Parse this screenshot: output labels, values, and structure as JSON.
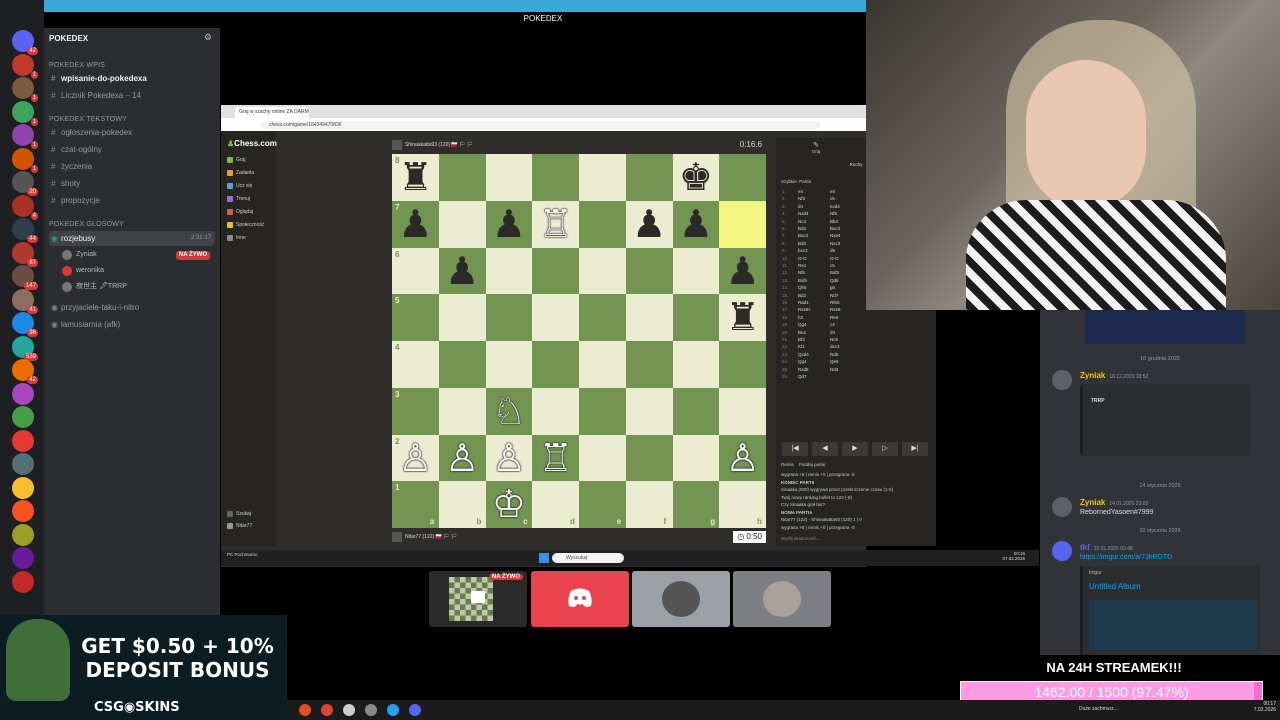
{
  "stream_title": "POKEDEX",
  "discord": {
    "server_name": "POKEDEX",
    "rail_badges": [
      "42",
      "1",
      "1",
      "1",
      "1",
      "1",
      "20",
      "4",
      "44",
      "87",
      "147",
      "41",
      "96",
      "539",
      "42"
    ],
    "categories": [
      {
        "label": "POKEDEX Wpis"
      },
      {
        "label": "POKEDEX Tekstowy"
      },
      {
        "label": "POKEDEX GŁOSOWY"
      }
    ],
    "channels_wpis": [
      "wpisanie-do-pokedexa",
      "Licznik Pokedexa – 14"
    ],
    "channels_text": [
      "ogłoszenia-pokedex",
      "czat-ogólny",
      "życzenia",
      "shoty",
      "propozycje"
    ],
    "voice_channel": {
      "name": "rozjebusy",
      "time": "2:31:17"
    },
    "voice_users": [
      {
        "name": "Zyniak",
        "live": "NA ŻYWO"
      },
      {
        "name": "weronika",
        "live": ""
      },
      {
        "name": "寂世主 🖋TRRP",
        "live": ""
      }
    ],
    "other_voice": [
      "przyjaciele-taku-i-nitro",
      "lamusiarnia (afk)"
    ]
  },
  "browser": {
    "tab_title": "Graj w szachy online ZA DARM",
    "url": "chess.com/game/164349470836"
  },
  "chess": {
    "logo": "Chess.com",
    "menu": [
      "Graj",
      "Zadania",
      "Ucz się",
      "Trenuj",
      "Oglądaj",
      "Społeczność",
      "Inne"
    ],
    "bottom_menu": [
      "Szukaj",
      "Nitar77"
    ],
    "top_player": "Shinaakatta93 (120) 🇵🇱 🏳 🏳",
    "top_clock": "0:16.6",
    "bottom_player": "Nitar77 (122) 🇵🇱 🏳 🏳",
    "bottom_clock": "0:50",
    "ranks": [
      "8",
      "7",
      "6",
      "5",
      "4",
      "3",
      "2",
      "1"
    ],
    "files": [
      "a",
      "b",
      "c",
      "d",
      "e",
      "f",
      "g",
      "h"
    ],
    "pieces": [
      {
        "sq": "a8",
        "p": "♜",
        "c": "b"
      },
      {
        "sq": "g8",
        "p": "♚",
        "c": "b"
      },
      {
        "sq": "a7",
        "p": "♟",
        "c": "b"
      },
      {
        "sq": "c7",
        "p": "♟",
        "c": "b"
      },
      {
        "sq": "d7",
        "p": "♖",
        "c": "w"
      },
      {
        "sq": "f7",
        "p": "♟",
        "c": "b"
      },
      {
        "sq": "g7",
        "p": "♟",
        "c": "b"
      },
      {
        "sq": "b6",
        "p": "♟",
        "c": "b"
      },
      {
        "sq": "h6",
        "p": "♟",
        "c": "b"
      },
      {
        "sq": "h5",
        "p": "♜",
        "c": "b"
      },
      {
        "sq": "c3",
        "p": "♘",
        "c": "w"
      },
      {
        "sq": "a2",
        "p": "♙",
        "c": "w"
      },
      {
        "sq": "b2",
        "p": "♙",
        "c": "w"
      },
      {
        "sq": "c2",
        "p": "♙",
        "c": "w"
      },
      {
        "sq": "d2",
        "p": "♖",
        "c": "w"
      },
      {
        "sq": "h2",
        "p": "♙",
        "c": "w"
      },
      {
        "sq": "c1",
        "p": "♔",
        "c": "w"
      }
    ],
    "highlight": [
      "h7"
    ],
    "panel_tabs": [
      "Graj",
      "Nowa partia"
    ],
    "panel_sub": "Ruchy",
    "panel_head": "Szybkie: Partia",
    "moves": [
      [
        "1.",
        "e4",
        "e5"
      ],
      [
        "2.",
        "Nf3",
        "c6"
      ],
      [
        "3.",
        "d4",
        "exd4"
      ],
      [
        "4.",
        "Nxd4",
        "Nf6"
      ],
      [
        "5.",
        "Nc3",
        "Bb4"
      ],
      [
        "6.",
        "Bd2",
        "Bxc3"
      ],
      [
        "7.",
        "Bxc3",
        "Nxe4"
      ],
      [
        "8.",
        "Bd3",
        "Nxc3"
      ],
      [
        "9.",
        "bxc3",
        "d5"
      ],
      [
        "10.",
        "O-O",
        "O-O"
      ],
      [
        "11.",
        "Re1",
        "c5"
      ],
      [
        "12.",
        "Nf5",
        "Bxf5"
      ],
      [
        "13.",
        "Bxf5",
        "Qd6"
      ],
      [
        "14.",
        "Qh5",
        "g6"
      ],
      [
        "15.",
        "Bd3",
        "Nd7"
      ],
      [
        "16.",
        "Rad1",
        "Rfe8"
      ],
      [
        "17.",
        "Rxe8+",
        "Rxe8"
      ],
      [
        "18.",
        "h3",
        "Re6"
      ],
      [
        "19.",
        "Qg4",
        "c4"
      ],
      [
        "20.",
        "Be2",
        "d4"
      ],
      [
        "21.",
        "Bf3",
        "Nc5"
      ],
      [
        "22.",
        "Kf1",
        "dxc3"
      ],
      [
        "23.",
        "Qxd4",
        "Rd6"
      ],
      [
        "24.",
        "Qg4",
        "Qe5"
      ],
      [
        "25.",
        "Rxd6",
        "Nd3"
      ],
      [
        "26.",
        "Qd7",
        ""
      ]
    ],
    "nav": [
      "|◀",
      "◀",
      "▶",
      "▷",
      "▶|"
    ],
    "panel_actions": [
      "Remis",
      "Poddaj partię"
    ],
    "result_lines": [
      "wygrana +8 | remis +0 | przegrana -8",
      "KONIEC PARTII",
      "Sinaaka (500) wygrywa przez przekroczenie czasu (1-0)",
      "Twój nowy ranking bullet to 122 (-8)",
      "Czy Sinaaka grał fair?",
      "NOWA PARTIA",
      "Nitar77 (122) - Shinaakatta93 (120) 1 | 0",
      "wygrana +8 | remis +0 | przegrana -8"
    ],
    "chat_placeholder": "Wyślij wiadomość..."
  },
  "win_task": {
    "search": "Wyszukaj",
    "weather": "PC Pochmurno",
    "time": "00:16",
    "date": "07.02.2026"
  },
  "thumbs": [
    {
      "live": "NA ŻYWO"
    }
  ],
  "chat": {
    "divider1": "16 grudnia 2025",
    "m1_user": "Zyniak",
    "m1_time": "16.12.2025 18:52",
    "m1_embed": "TRRP",
    "divider2": "14 stycznia 2026",
    "m2_user": "Zyniak",
    "m2_time": "14.01.2026 23:03",
    "m2_text": "RebornedYasoen#7999",
    "divider3": "20 stycznia 2026",
    "m3_user": "tkf",
    "m3_time": "20.01.2026 03:48",
    "m3_link": "https://imgur.com/a/73kROTD",
    "m3_site": "Imgur",
    "m3_title": "Untitled Album"
  },
  "ad": {
    "line1": "GET $0.50 + 10%",
    "line2": "DEPOSIT BONUS",
    "brand": "CSG◉SKINS"
  },
  "goal": {
    "title": "NA 24H STREAMEK!!!",
    "text": "1462.00 / 1500 (97.47%)",
    "fraction": 0.9747
  },
  "bottom_task": {
    "weather": "Duże zachmurz...",
    "time": "00:17",
    "date": "7.02.2026"
  },
  "colors": {
    "accent_live": "#da373c",
    "board_light": "#ebecd0",
    "board_dark": "#739552",
    "goal_pink": "#ff6bd5"
  }
}
